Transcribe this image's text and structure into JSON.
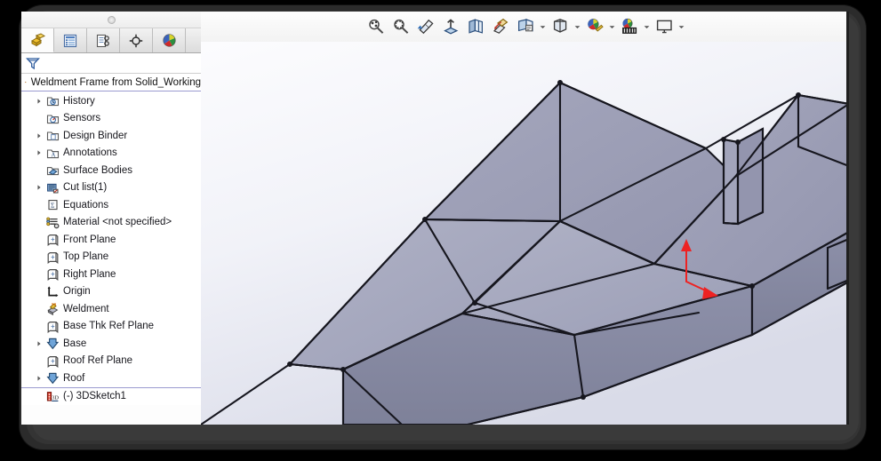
{
  "window": {
    "bezel_color": "#2b2b2b",
    "screen_background": "#ffffff"
  },
  "feature_manager": {
    "grip_label": "panel-grip",
    "tabs": [
      {
        "id": "feature-manager",
        "label": "FeatureManager design tree",
        "icon": "yellow-blocks-icon",
        "active": true
      },
      {
        "id": "property-manager",
        "label": "PropertyManager",
        "icon": "blue-list-icon",
        "active": false
      },
      {
        "id": "configuration-manager",
        "label": "ConfigurationManager",
        "icon": "configuration-icon",
        "active": false
      },
      {
        "id": "dimxpert-manager",
        "label": "DimXpertManager",
        "icon": "crosshair-icon",
        "active": false
      },
      {
        "id": "display-manager",
        "label": "DisplayManager",
        "icon": "color-wheel-icon",
        "active": false
      }
    ],
    "filter": {
      "icon": "filter-funnel-icon",
      "placeholder": ""
    },
    "document_title": "Weldment Frame from Solid_Working",
    "document_icon": "part-document-icon",
    "tree": [
      {
        "label": "History",
        "icon": "history-icon",
        "expandable": true,
        "indent": 0
      },
      {
        "label": "Sensors",
        "icon": "sensors-icon",
        "expandable": false,
        "indent": 0
      },
      {
        "label": "Design Binder",
        "icon": "design-binder-icon",
        "expandable": true,
        "indent": 0
      },
      {
        "label": "Annotations",
        "icon": "annotations-icon",
        "expandable": true,
        "indent": 0
      },
      {
        "label": "Surface Bodies",
        "icon": "surface-bodies-icon",
        "expandable": false,
        "indent": 0
      },
      {
        "label": "Cut list(1)",
        "icon": "cut-list-icon",
        "expandable": true,
        "indent": 0
      },
      {
        "label": "Equations",
        "icon": "equations-icon",
        "expandable": false,
        "indent": 0
      },
      {
        "label": "Material <not specified>",
        "icon": "material-icon",
        "expandable": false,
        "indent": 0
      },
      {
        "label": "Front Plane",
        "icon": "plane-icon",
        "expandable": false,
        "indent": 0
      },
      {
        "label": "Top Plane",
        "icon": "plane-icon",
        "expandable": false,
        "indent": 0
      },
      {
        "label": "Right Plane",
        "icon": "plane-icon",
        "expandable": false,
        "indent": 0
      },
      {
        "label": "Origin",
        "icon": "origin-icon",
        "expandable": false,
        "indent": 0
      },
      {
        "label": "Weldment",
        "icon": "weldment-icon",
        "expandable": false,
        "indent": 0
      },
      {
        "label": "Base Thk Ref Plane",
        "icon": "plane-icon",
        "expandable": false,
        "indent": 0
      },
      {
        "label": "Base",
        "icon": "extrude-icon",
        "expandable": true,
        "indent": 0
      },
      {
        "label": "Roof Ref Plane",
        "icon": "plane-icon",
        "expandable": false,
        "indent": 0
      },
      {
        "label": "Roof",
        "icon": "extrude-icon",
        "expandable": true,
        "indent": 0
      },
      {
        "label": "(-) 3DSketch1",
        "icon": "sketch3d-icon",
        "expandable": false,
        "indent": 0,
        "separator": true
      }
    ]
  },
  "viewport": {
    "toolbar": [
      {
        "id": "zoom-to-fit",
        "icon": "zoom-to-fit-icon",
        "caret": false
      },
      {
        "id": "zoom-to-area",
        "icon": "zoom-to-area-icon",
        "caret": false
      },
      {
        "id": "previous-view",
        "icon": "previous-view-icon",
        "caret": false
      },
      {
        "id": "section-view",
        "icon": "section-view-icon",
        "caret": false
      },
      {
        "id": "view-orientation",
        "icon": "view-orientation-icon",
        "caret": false
      },
      {
        "id": "3d-drawing-view",
        "icon": "3d-drawing-view-icon",
        "caret": false
      },
      {
        "id": "display-style",
        "icon": "display-style-icon",
        "caret": true
      },
      {
        "id": "hide-show-items",
        "icon": "hide-show-items-icon",
        "caret": true
      },
      {
        "id": "edit-appearance",
        "icon": "edit-appearance-icon",
        "caret": true
      },
      {
        "id": "apply-scene",
        "icon": "apply-scene-icon",
        "caret": true
      },
      {
        "id": "view-settings",
        "icon": "view-settings-icon",
        "caret": true
      }
    ],
    "model": {
      "name": "weldment-frame-model",
      "shading": "shaded-with-edges",
      "face_light": "#a9abc0",
      "face_mid": "#9a9cb4",
      "face_dark": "#8a8da6",
      "edge_color": "#16161e",
      "triad_color": "#ee2222",
      "background_top": "#fbfbfd",
      "background_bottom": "#dcdee9"
    }
  }
}
